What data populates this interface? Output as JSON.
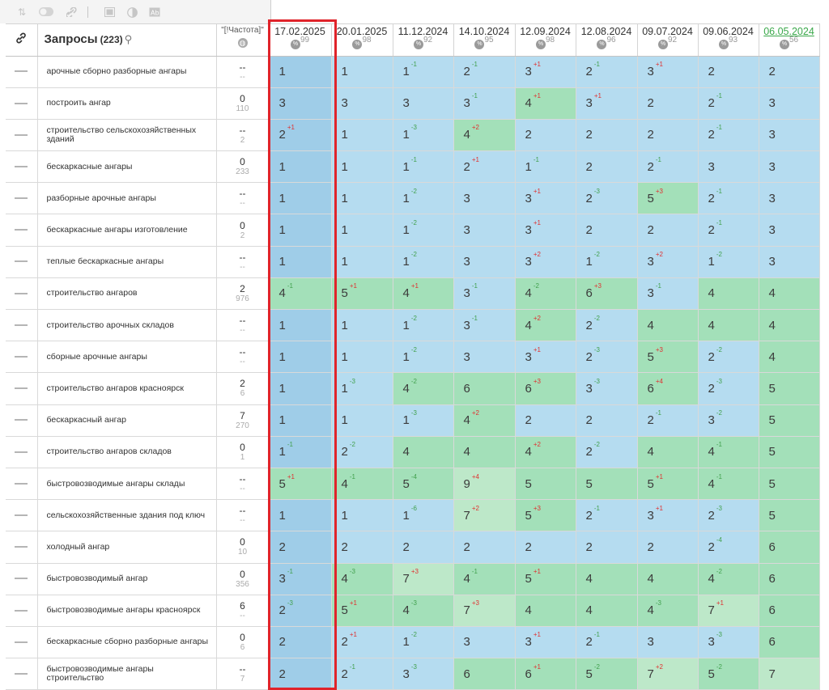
{
  "toolbar": {
    "icons": [
      "sort-icon",
      "toggle-icon",
      "link-icon",
      "grid-icon",
      "contrast-icon",
      "font-icon"
    ]
  },
  "header": {
    "query_title": "Запросы",
    "query_count": "(223)",
    "freq_label": "\"[!Частота]\"",
    "dates": [
      {
        "date": "17.02.2025",
        "pct": "99",
        "green": false
      },
      {
        "date": "20.01.2025",
        "pct": "98",
        "green": false
      },
      {
        "date": "11.12.2024",
        "pct": "92",
        "green": false
      },
      {
        "date": "14.10.2024",
        "pct": "95",
        "green": false
      },
      {
        "date": "12.09.2024",
        "pct": "98",
        "green": false
      },
      {
        "date": "12.08.2024",
        "pct": "96",
        "green": false
      },
      {
        "date": "09.07.2024",
        "pct": "92",
        "green": false
      },
      {
        "date": "09.06.2024",
        "pct": "93",
        "green": false
      },
      {
        "date": "06.05.2024",
        "pct": "56",
        "green": true
      }
    ]
  },
  "colors": {
    "blue_dark": "#9fcde8",
    "blue_light": "#b5dcf0",
    "green": "#a3e0b9",
    "green_dark": "#8fd8a8",
    "green_light": "#bde8c9",
    "highlight_border": "#e0232a"
  },
  "rows": [
    {
      "q": "арочные сборно разборные ангары",
      "f1": "--",
      "f2": "--",
      "cells": [
        [
          "1",
          ""
        ],
        [
          "1",
          ""
        ],
        [
          "1",
          "-1"
        ],
        [
          "2",
          "-1"
        ],
        [
          "3",
          "+1"
        ],
        [
          "2",
          "-1"
        ],
        [
          "3",
          "+1"
        ],
        [
          "2",
          ""
        ],
        [
          "2",
          ""
        ]
      ]
    },
    {
      "q": "построить ангар",
      "f1": "0",
      "f2": "110",
      "cells": [
        [
          "3",
          ""
        ],
        [
          "3",
          ""
        ],
        [
          "3",
          ""
        ],
        [
          "3",
          "-1"
        ],
        [
          "4",
          "+1"
        ],
        [
          "3",
          "+1"
        ],
        [
          "2",
          ""
        ],
        [
          "2",
          "-1"
        ],
        [
          "3",
          ""
        ]
      ]
    },
    {
      "q": "строительство сельскохозяйственных зданий",
      "f1": "--",
      "f2": "2",
      "cells": [
        [
          "2",
          "+1"
        ],
        [
          "1",
          ""
        ],
        [
          "1",
          "-3"
        ],
        [
          "4",
          "+2"
        ],
        [
          "2",
          ""
        ],
        [
          "2",
          ""
        ],
        [
          "2",
          ""
        ],
        [
          "2",
          "-1"
        ],
        [
          "3",
          ""
        ]
      ]
    },
    {
      "q": "бескаркасные ангары",
      "f1": "0",
      "f2": "233",
      "cells": [
        [
          "1",
          ""
        ],
        [
          "1",
          ""
        ],
        [
          "1",
          "-1"
        ],
        [
          "2",
          "+1"
        ],
        [
          "1",
          "-1"
        ],
        [
          "2",
          ""
        ],
        [
          "2",
          "-1"
        ],
        [
          "3",
          ""
        ],
        [
          "3",
          ""
        ]
      ]
    },
    {
      "q": "разборные арочные ангары",
      "f1": "--",
      "f2": "--",
      "cells": [
        [
          "1",
          ""
        ],
        [
          "1",
          ""
        ],
        [
          "1",
          "-2"
        ],
        [
          "3",
          ""
        ],
        [
          "3",
          "+1"
        ],
        [
          "2",
          "-3"
        ],
        [
          "5",
          "+3"
        ],
        [
          "2",
          "-1"
        ],
        [
          "3",
          ""
        ]
      ]
    },
    {
      "q": "бескаркасные ангары изготовление",
      "f1": "0",
      "f2": "2",
      "cells": [
        [
          "1",
          ""
        ],
        [
          "1",
          ""
        ],
        [
          "1",
          "-2"
        ],
        [
          "3",
          ""
        ],
        [
          "3",
          "+1"
        ],
        [
          "2",
          ""
        ],
        [
          "2",
          ""
        ],
        [
          "2",
          "-1"
        ],
        [
          "3",
          ""
        ]
      ]
    },
    {
      "q": "теплые бескаркасные ангары",
      "f1": "--",
      "f2": "--",
      "cells": [
        [
          "1",
          ""
        ],
        [
          "1",
          ""
        ],
        [
          "1",
          "-2"
        ],
        [
          "3",
          ""
        ],
        [
          "3",
          "+2"
        ],
        [
          "1",
          "-2"
        ],
        [
          "3",
          "+2"
        ],
        [
          "1",
          "-2"
        ],
        [
          "3",
          ""
        ]
      ]
    },
    {
      "q": "строительство ангаров",
      "f1": "2",
      "f2": "976",
      "cells": [
        [
          "4",
          "-1"
        ],
        [
          "5",
          "+1"
        ],
        [
          "4",
          "+1"
        ],
        [
          "3",
          "-1"
        ],
        [
          "4",
          "-2"
        ],
        [
          "6",
          "+3"
        ],
        [
          "3",
          "-1"
        ],
        [
          "4",
          ""
        ],
        [
          "4",
          ""
        ]
      ]
    },
    {
      "q": "строительство арочных складов",
      "f1": "--",
      "f2": "--",
      "cells": [
        [
          "1",
          ""
        ],
        [
          "1",
          ""
        ],
        [
          "1",
          "-2"
        ],
        [
          "3",
          "-1"
        ],
        [
          "4",
          "+2"
        ],
        [
          "2",
          "-2"
        ],
        [
          "4",
          ""
        ],
        [
          "4",
          ""
        ],
        [
          "4",
          ""
        ]
      ]
    },
    {
      "q": "сборные арочные ангары",
      "f1": "--",
      "f2": "--",
      "cells": [
        [
          "1",
          ""
        ],
        [
          "1",
          ""
        ],
        [
          "1",
          "-2"
        ],
        [
          "3",
          ""
        ],
        [
          "3",
          "+1"
        ],
        [
          "2",
          "-3"
        ],
        [
          "5",
          "+3"
        ],
        [
          "2",
          "-2"
        ],
        [
          "4",
          ""
        ]
      ]
    },
    {
      "q": "строительство ангаров красноярск",
      "f1": "2",
      "f2": "6",
      "cells": [
        [
          "1",
          ""
        ],
        [
          "1",
          "-3"
        ],
        [
          "4",
          "-2"
        ],
        [
          "6",
          ""
        ],
        [
          "6",
          "+3"
        ],
        [
          "3",
          "-3"
        ],
        [
          "6",
          "+4"
        ],
        [
          "2",
          "-3"
        ],
        [
          "5",
          ""
        ]
      ]
    },
    {
      "q": "бескаркасный ангар",
      "f1": "7",
      "f2": "270",
      "cells": [
        [
          "1",
          ""
        ],
        [
          "1",
          ""
        ],
        [
          "1",
          "-3"
        ],
        [
          "4",
          "+2"
        ],
        [
          "2",
          ""
        ],
        [
          "2",
          ""
        ],
        [
          "2",
          "-1"
        ],
        [
          "3",
          "-2"
        ],
        [
          "5",
          ""
        ]
      ]
    },
    {
      "q": "строительство ангаров складов",
      "f1": "0",
      "f2": "1",
      "cells": [
        [
          "1",
          "-1"
        ],
        [
          "2",
          "-2"
        ],
        [
          "4",
          ""
        ],
        [
          "4",
          ""
        ],
        [
          "4",
          "+2"
        ],
        [
          "2",
          "-2"
        ],
        [
          "4",
          ""
        ],
        [
          "4",
          "-1"
        ],
        [
          "5",
          ""
        ]
      ]
    },
    {
      "q": "быстровозводимые ангары склады",
      "f1": "--",
      "f2": "--",
      "cells": [
        [
          "5",
          "+1"
        ],
        [
          "4",
          "-1"
        ],
        [
          "5",
          "-4"
        ],
        [
          "9",
          "+4"
        ],
        [
          "5",
          ""
        ],
        [
          "5",
          ""
        ],
        [
          "5",
          "+1"
        ],
        [
          "4",
          "-1"
        ],
        [
          "5",
          ""
        ]
      ]
    },
    {
      "q": "сельскохозяйственные здания под ключ",
      "f1": "--",
      "f2": "--",
      "cells": [
        [
          "1",
          ""
        ],
        [
          "1",
          ""
        ],
        [
          "1",
          "-6"
        ],
        [
          "7",
          "+2"
        ],
        [
          "5",
          "+3"
        ],
        [
          "2",
          "-1"
        ],
        [
          "3",
          "+1"
        ],
        [
          "2",
          "-3"
        ],
        [
          "5",
          ""
        ]
      ]
    },
    {
      "q": "холодный ангар",
      "f1": "0",
      "f2": "10",
      "cells": [
        [
          "2",
          ""
        ],
        [
          "2",
          ""
        ],
        [
          "2",
          ""
        ],
        [
          "2",
          ""
        ],
        [
          "2",
          ""
        ],
        [
          "2",
          ""
        ],
        [
          "2",
          ""
        ],
        [
          "2",
          "-4"
        ],
        [
          "6",
          ""
        ]
      ]
    },
    {
      "q": "быстровозводимый ангар",
      "f1": "0",
      "f2": "356",
      "cells": [
        [
          "3",
          "-1"
        ],
        [
          "4",
          "-3"
        ],
        [
          "7",
          "+3"
        ],
        [
          "4",
          "-1"
        ],
        [
          "5",
          "+1"
        ],
        [
          "4",
          ""
        ],
        [
          "4",
          ""
        ],
        [
          "4",
          "-2"
        ],
        [
          "6",
          ""
        ]
      ]
    },
    {
      "q": "быстровозводимые ангары красноярск",
      "f1": "6",
      "f2": "--",
      "cells": [
        [
          "2",
          "-3"
        ],
        [
          "5",
          "+1"
        ],
        [
          "4",
          "-3"
        ],
        [
          "7",
          "+3"
        ],
        [
          "4",
          ""
        ],
        [
          "4",
          ""
        ],
        [
          "4",
          "-3"
        ],
        [
          "7",
          "+1"
        ],
        [
          "6",
          ""
        ]
      ]
    },
    {
      "q": "бескаркасные сборно разборные ангары",
      "f1": "0",
      "f2": "6",
      "cells": [
        [
          "2",
          ""
        ],
        [
          "2",
          "+1"
        ],
        [
          "1",
          "-2"
        ],
        [
          "3",
          ""
        ],
        [
          "3",
          "+1"
        ],
        [
          "2",
          "-1"
        ],
        [
          "3",
          ""
        ],
        [
          "3",
          "-3"
        ],
        [
          "6",
          ""
        ]
      ]
    },
    {
      "q": "быстровозводимые ангары строительство",
      "f1": "--",
      "f2": "7",
      "cells": [
        [
          "2",
          ""
        ],
        [
          "2",
          "-1"
        ],
        [
          "3",
          "-3"
        ],
        [
          "6",
          ""
        ],
        [
          "6",
          "+1"
        ],
        [
          "5",
          "-2"
        ],
        [
          "7",
          "+2"
        ],
        [
          "5",
          "-2"
        ],
        [
          "7",
          ""
        ]
      ]
    }
  ]
}
